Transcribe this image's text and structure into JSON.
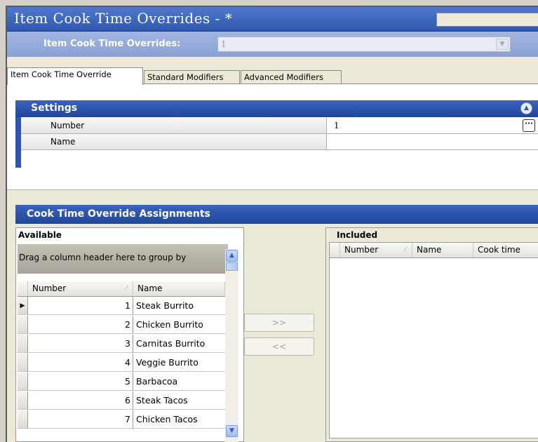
{
  "window": {
    "title": "Item Cook Time Overrides - *"
  },
  "selector": {
    "label": "Item Cook Time Overrides:",
    "value": "1"
  },
  "tabs": [
    {
      "label": "Item Cook Time Override",
      "active": true
    },
    {
      "label": "Standard Modifiers",
      "active": false
    },
    {
      "label": "Advanced Modifiers",
      "active": false
    }
  ],
  "settings": {
    "title": "Settings",
    "rows": [
      {
        "label": "Number",
        "value": "1"
      },
      {
        "label": "Name",
        "value": ""
      }
    ]
  },
  "assignments": {
    "title": "Cook Time Override Assignments",
    "available": {
      "label": "Available",
      "group_hint": "Drag a column header here to group by",
      "columns": [
        "Number",
        "Name"
      ],
      "rows": [
        {
          "number": "1",
          "name": "Steak Burrito"
        },
        {
          "number": "2",
          "name": "Chicken Burrito"
        },
        {
          "number": "3",
          "name": "Carnitas Burrito"
        },
        {
          "number": "4",
          "name": "Veggie Burrito"
        },
        {
          "number": "5",
          "name": "Barbacoa"
        },
        {
          "number": "6",
          "name": "Steak Tacos"
        },
        {
          "number": "7",
          "name": "Chicken Tacos"
        }
      ]
    },
    "buttons": {
      "add": ">>",
      "remove": "<<"
    },
    "included": {
      "label": "Included",
      "columns": [
        "Number",
        "Name",
        "Cook time"
      ]
    }
  },
  "icons": {
    "collapse": "chevron-up-double-icon",
    "ellipsis": "ellipsis-icon",
    "row_pointer": "row-pointer-icon",
    "sort": "sort-indicator-icon"
  }
}
